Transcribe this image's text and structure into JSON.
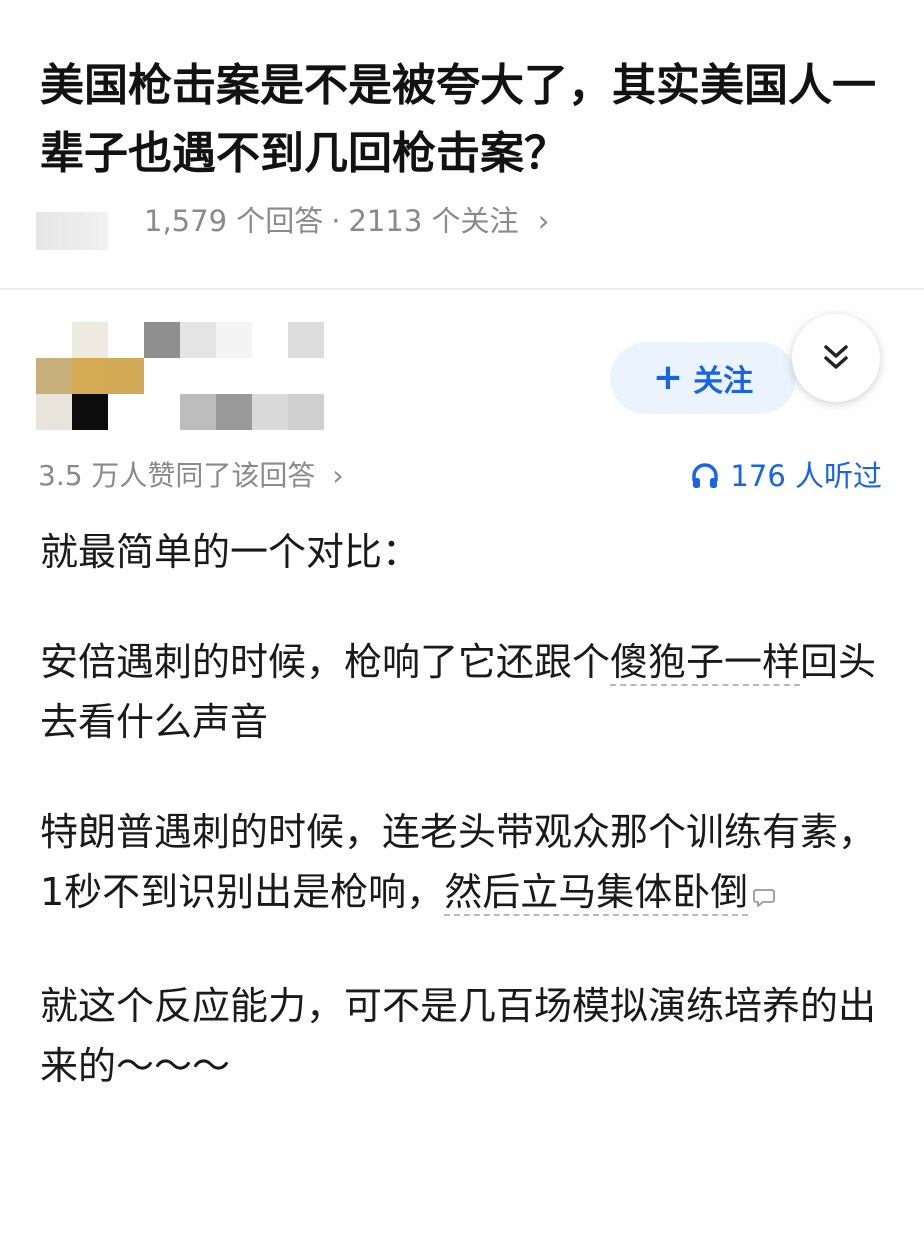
{
  "question": {
    "title": "美国枪击案是不是被夸大了，其实美国人一辈子也遇不到几回枪击案？",
    "answers_count": "1,579 个回答",
    "followers_count": "2113 个关注",
    "separator": "·",
    "chevron": "›"
  },
  "author": {
    "follow_label": "关注",
    "follow_plus": "+",
    "collapse_icon": "double-chevron-down-icon"
  },
  "answer_meta": {
    "agree_text": "3.5 万人赞同了该回答",
    "agree_chevron": "›",
    "listen_text": "176 人听过",
    "listen_icon": "headphones-icon"
  },
  "answer": {
    "p1": "就最简单的一个对比：",
    "p2_a": "安倍遇刺的时候，枪响了它还跟个",
    "p2_kw": "傻狍子一样",
    "p2_b": "回头去看什么声音",
    "p3_a": "特朗普遇刺的时候，连老头带观众那个训练有素，1秒不到识别出是枪响，",
    "p3_kw": "然后立马集体卧倒",
    "p4": "就这个反应能力，可不是几百场模拟演练培养的出来的～～～"
  },
  "colors": {
    "accent": "#1765e6",
    "follow_bg": "#ebf3fe",
    "muted_text": "#8a8a8a"
  }
}
